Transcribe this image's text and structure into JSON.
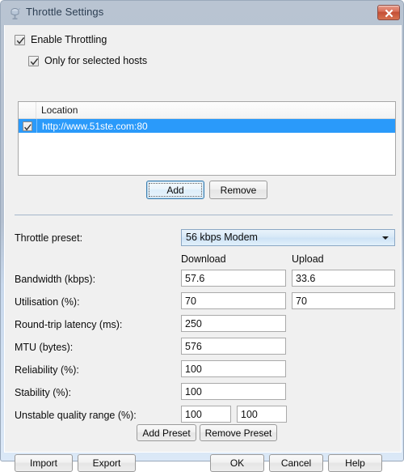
{
  "window": {
    "title": "Throttle Settings",
    "icon": "throttle-icon",
    "close_label": "x",
    "accent_selection": "#2a9afa",
    "titlebar_color": "#b4c0d0",
    "body_color": "#f0f0f0"
  },
  "options": {
    "enable_throttling": {
      "label": "Enable Throttling",
      "checked": true
    },
    "only_selected_hosts": {
      "label": "Only for selected hosts",
      "checked": true
    }
  },
  "host_list": {
    "columns": [
      "",
      "Location"
    ],
    "rows": [
      {
        "checked": true,
        "location": "http://www.51ste.com:80",
        "selected": true
      }
    ]
  },
  "list_buttons": {
    "add": "Add",
    "remove": "Remove"
  },
  "preset": {
    "label": "Throttle preset:",
    "selected": "56 kbps Modem",
    "options": [
      "56 kbps Modem"
    ]
  },
  "column_headers": {
    "download": "Download",
    "upload": "Upload"
  },
  "fields": [
    {
      "label": "Bandwidth (kbps):",
      "download": "57.6",
      "upload": "33.6",
      "dual": true
    },
    {
      "label": "Utilisation (%):",
      "download": "70",
      "upload": "70",
      "dual": true
    },
    {
      "label": "Round-trip latency (ms):",
      "download": "250",
      "upload": null,
      "dual": false
    },
    {
      "label": "MTU (bytes):",
      "download": "576",
      "upload": null,
      "dual": false
    },
    {
      "label": "Reliability (%):",
      "download": "100",
      "upload": null,
      "dual": false
    },
    {
      "label": "Stability (%):",
      "download": "100",
      "upload": null,
      "dual": false
    }
  ],
  "unstable": {
    "label": "Unstable quality range (%):",
    "min": "100",
    "max": "100"
  },
  "preset_buttons": {
    "add_preset": "Add Preset",
    "remove_preset": "Remove Preset"
  },
  "footer": {
    "import": "Import",
    "export": "Export",
    "ok": "OK",
    "cancel": "Cancel",
    "help": "Help"
  }
}
